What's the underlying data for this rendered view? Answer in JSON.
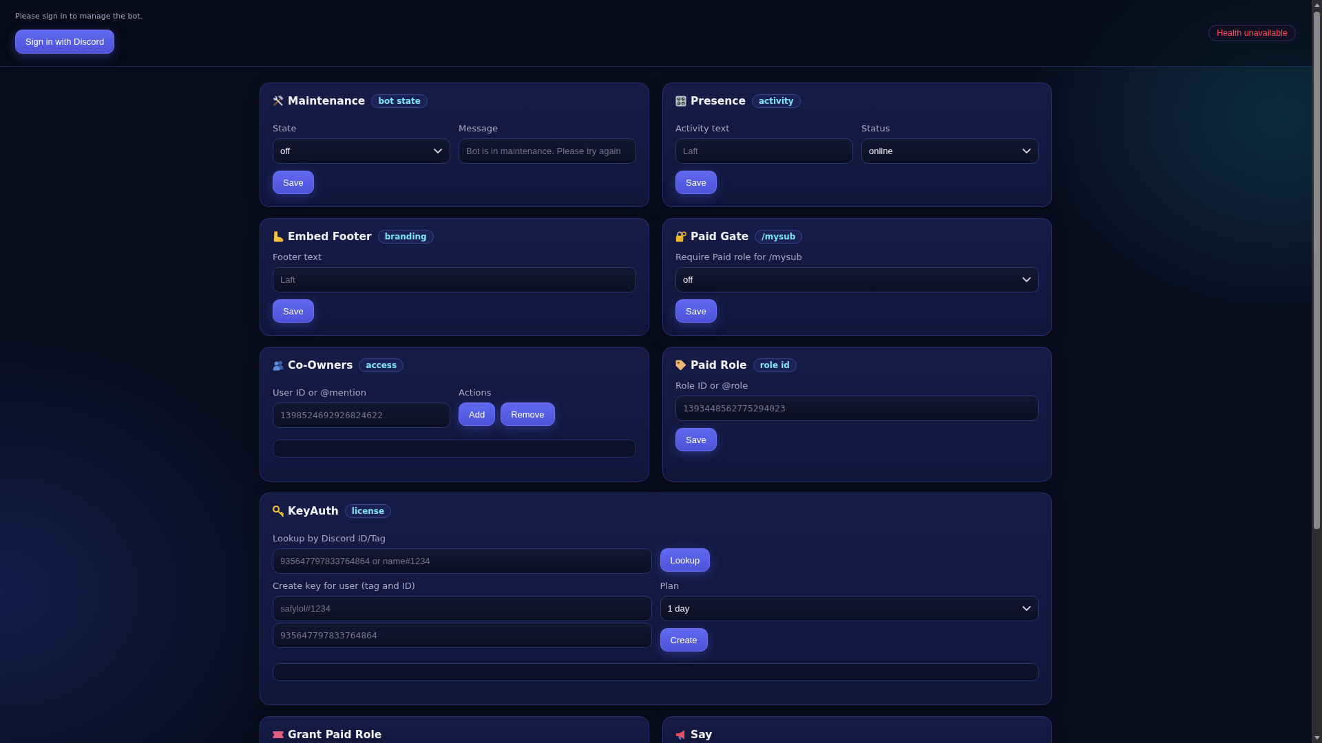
{
  "header": {
    "notice": "Please sign in to manage the bot.",
    "sign_in_button": "Sign in with Discord",
    "health_badge": "Health unavailable"
  },
  "card_rows": [
    [
      {
        "title": "Maintenance",
        "badge": "bot state",
        "rows": [
          [
            {
              "label": "State",
              "controls": [
                {
                  "kind": "select",
                  "value": "off"
                }
              ]
            },
            {
              "label": "Message",
              "controls": [
                {
                  "kind": "input",
                  "placeholder": "Bot is in maintenance. Please try again"
                }
              ]
            }
          ],
          [
            {
              "controls": [
                {
                  "kind": "button",
                  "label": "Save"
                }
              ]
            }
          ]
        ]
      },
      {
        "title": "Presence",
        "badge": "activity",
        "rows": [
          [
            {
              "label": "Activity text",
              "controls": [
                {
                  "kind": "input",
                  "placeholder": "Laft"
                }
              ]
            },
            {
              "label": "Status",
              "controls": [
                {
                  "kind": "select",
                  "value": "online"
                }
              ]
            }
          ],
          [
            {
              "controls": [
                {
                  "kind": "button",
                  "label": "Save"
                }
              ]
            }
          ]
        ]
      }
    ],
    [
      {
        "title": "Embed Footer",
        "badge": "branding",
        "rows": [
          [
            {
              "label": "Footer text",
              "controls": [
                {
                  "kind": "input",
                  "placeholder": "Laft"
                }
              ]
            }
          ],
          [
            {
              "controls": [
                {
                  "kind": "button",
                  "label": "Save"
                }
              ]
            }
          ]
        ]
      },
      {
        "title": "Paid Gate",
        "badge": "/mysub",
        "rows": [
          [
            {
              "label": "Require Paid role for /mysub",
              "controls": [
                {
                  "kind": "select",
                  "value": "off"
                }
              ]
            }
          ],
          [
            {
              "controls": [
                {
                  "kind": "button",
                  "label": "Save"
                }
              ]
            }
          ]
        ]
      }
    ],
    [
      {
        "title": "Co-Owners",
        "badge": "access",
        "rows": [
          [
            {
              "label": "User ID or @mention",
              "controls": [
                {
                  "kind": "id_input",
                  "placeholder": "1398524692926824622"
                }
              ]
            },
            {
              "label": "Actions",
              "controls": [
                {
                  "kind": "button",
                  "label": "Add"
                },
                {
                  "kind": "button",
                  "label": "Remove"
                }
              ]
            }
          ],
          [
            {
              "controls": [
                {
                  "kind": "output"
                }
              ]
            }
          ]
        ]
      },
      {
        "title": "Paid Role",
        "badge": "role id",
        "rows": [
          [
            {
              "label": "Role ID or @role",
              "controls": [
                {
                  "kind": "id_input",
                  "placeholder": "1393448562775294023"
                }
              ]
            }
          ],
          [
            {
              "controls": [
                {
                  "kind": "button",
                  "label": "Save"
                }
              ]
            }
          ]
        ]
      }
    ],
    [
      {
        "title": "KeyAuth",
        "badge": "license",
        "rows": [
          [
            {
              "label": "Lookup by Discord ID/Tag",
              "controls": [
                {
                  "kind": "input",
                  "placeholder": "935647797833764864 or name#1234"
                }
              ]
            },
            {
              "controls": [
                {
                  "kind": "button",
                  "label": "Lookup"
                }
              ]
            }
          ],
          [
            {
              "label": "Create key for user (tag and ID)",
              "controls": [
                {
                  "kind": "input",
                  "placeholder": "safylol#1234"
                },
                {
                  "kind": "id_input",
                  "placeholder": "935647797833764864"
                }
              ]
            },
            {
              "label": "Plan",
              "controls": [
                {
                  "kind": "select",
                  "value": "1 day"
                },
                {
                  "kind": "button",
                  "label": "Create"
                }
              ]
            }
          ],
          [
            {
              "controls": [
                {
                  "kind": "output"
                }
              ]
            }
          ]
        ]
      }
    ],
    [
      {
        "title": "Grant Paid Role"
      },
      {
        "title": "Say"
      }
    ]
  ]
}
